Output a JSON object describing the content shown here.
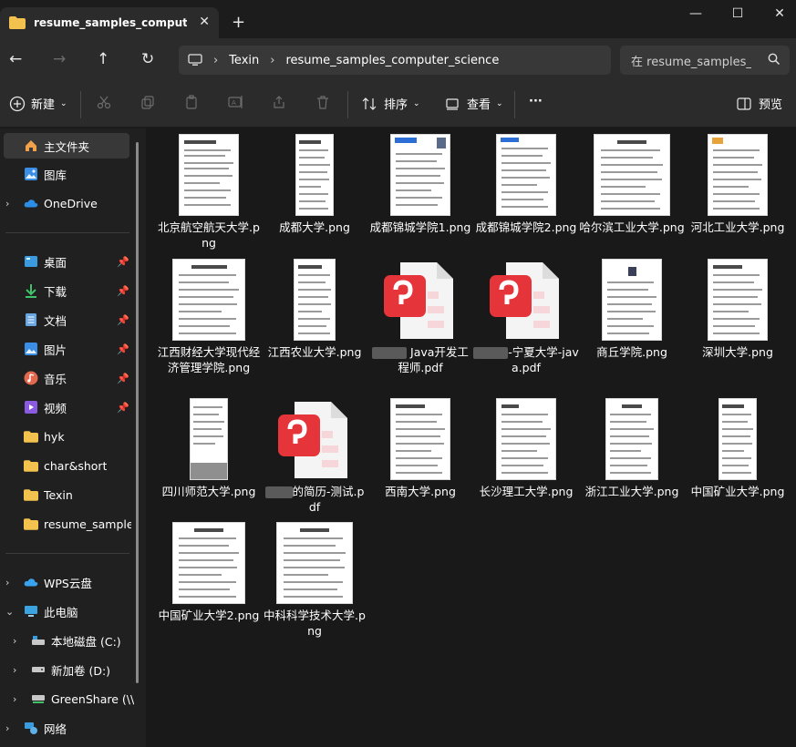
{
  "tab": {
    "title": "resume_samples_computer_science",
    "close": "✕",
    "new": "+"
  },
  "window": {
    "minimize": "—",
    "maximize": "☐",
    "close": "✕"
  },
  "nav": {
    "back": "←",
    "forward": "→",
    "up": "↑",
    "refresh": "↻"
  },
  "address": {
    "crumbs": [
      "Texin",
      "resume_samples_computer_science"
    ],
    "sep": "›"
  },
  "search": {
    "placeholder": "在 resume_samples_computer_science 中搜索"
  },
  "toolbar": {
    "new": "新建",
    "sort": "排序",
    "view": "查看",
    "more": "···",
    "preview": "预览"
  },
  "sidebar": {
    "home": "主文件夹",
    "gallery": "图库",
    "onedrive": "OneDrive",
    "desktop": "桌面",
    "downloads": "下载",
    "documents": "文档",
    "pictures": "图片",
    "music": "音乐",
    "videos": "视频",
    "hyk": "hyk",
    "charshort": "char&short",
    "texin": "Texin",
    "resume": "resume_samples_computer_science",
    "wps": "WPS云盘",
    "thispc": "此电脑",
    "diskc": "本地磁盘 (C:)",
    "diskd": "新加卷 (D:)",
    "greenshare": "GreenShare (\\\\",
    "network": "网络"
  },
  "files": [
    {
      "name": "北京航空航天大学.png",
      "type": "png"
    },
    {
      "name": "成都大学.png",
      "type": "png"
    },
    {
      "name": "成都锦城学院1.png",
      "type": "png"
    },
    {
      "name": "成都锦城学院2.png",
      "type": "png"
    },
    {
      "name": "哈尔滨工业大学.png",
      "type": "png"
    },
    {
      "name": "河北工业大学.png",
      "type": "png"
    },
    {
      "name": "江西财经大学现代经济管理学院.png",
      "type": "png"
    },
    {
      "name": "江西农业大学.png",
      "type": "png"
    },
    {
      "name": "Java开发工程师.pdf",
      "type": "pdf"
    },
    {
      "name": "-宁夏大学-java.pdf",
      "type": "pdf"
    },
    {
      "name": "商丘学院.png",
      "type": "png"
    },
    {
      "name": "深圳大学.png",
      "type": "png"
    },
    {
      "name": "四川师范大学.png",
      "type": "png"
    },
    {
      "name": "的简历-测试.pdf",
      "type": "pdf"
    },
    {
      "name": "西南大学.png",
      "type": "png"
    },
    {
      "name": "长沙理工大学.png",
      "type": "png"
    },
    {
      "name": "浙江工业大学.png",
      "type": "png"
    },
    {
      "name": "中国矿业大学.png",
      "type": "png"
    },
    {
      "name": "中国矿业大学2.png",
      "type": "png"
    },
    {
      "name": "中科科学技术大学.png",
      "type": "png"
    }
  ],
  "colors": {
    "accent": "#0078d4",
    "folder": "#f2c14e",
    "pdf_red": "#e5343a",
    "background": "#191919"
  }
}
